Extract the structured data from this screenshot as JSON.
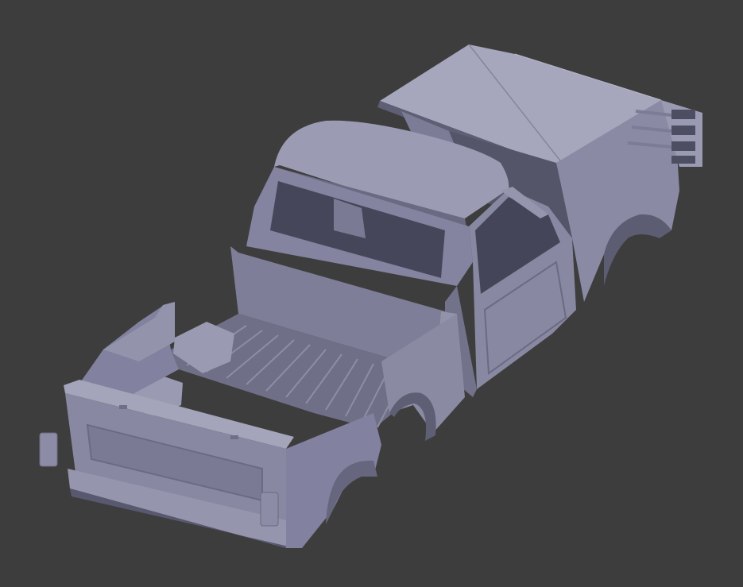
{
  "viewport": {
    "background_color": "#3d3d3d",
    "model": {
      "name": "pickup-truck-body",
      "base_color": "#8d8da7",
      "light_color": "#a7a7bd",
      "shadow_color": "#6e6e86",
      "dark_color": "#4f4f62"
    }
  }
}
